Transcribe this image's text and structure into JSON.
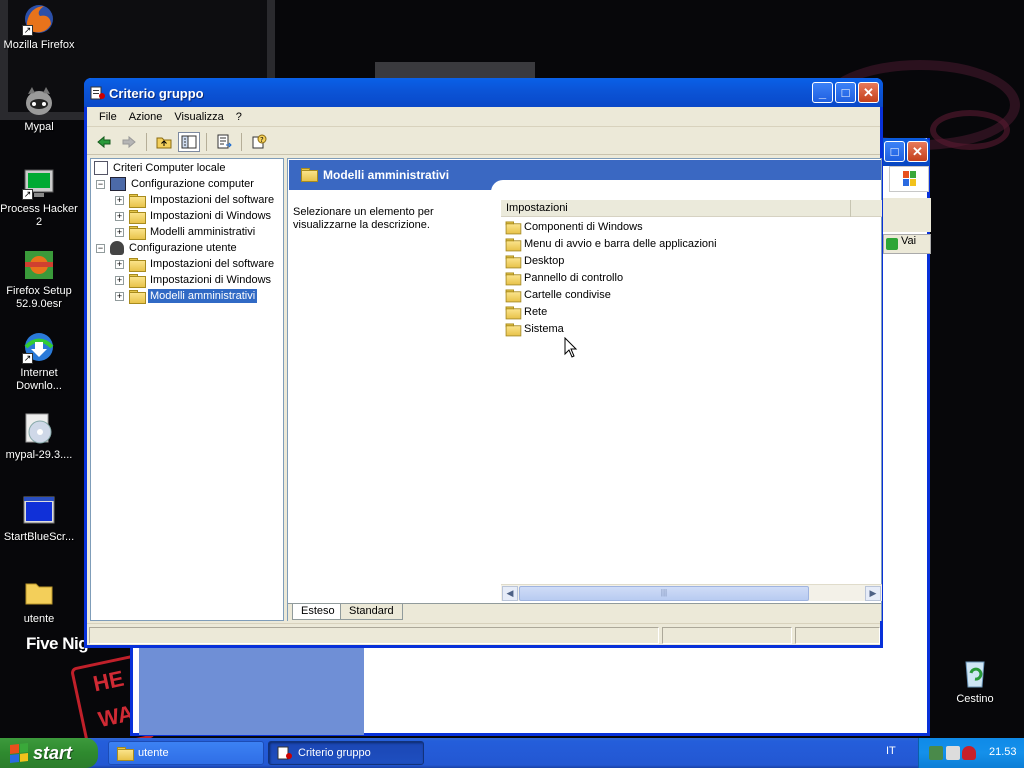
{
  "desktop": {
    "icons": [
      {
        "label": "Mozilla Firefox",
        "icon": "firefox-icon"
      },
      {
        "label": "Mypal",
        "icon": "mypal-icon"
      },
      {
        "label": "Process Hacker 2",
        "icon": "process-hacker-icon"
      },
      {
        "label": "Firefox Setup 52.9.0esr",
        "icon": "installer-icon"
      },
      {
        "label": "Internet Downlo...",
        "icon": "idm-icon"
      },
      {
        "label": "mypal-29.3....",
        "icon": "disc-icon"
      },
      {
        "label": "StartBlueScr...",
        "icon": "blue-screen-icon"
      },
      {
        "label": "utente",
        "icon": "folder-icon"
      },
      {
        "label": "Cestino",
        "icon": "recycle-bin-icon"
      }
    ],
    "wallpaper_text": "Five Nig",
    "neon_text": "HE WA"
  },
  "background_window": {
    "go_label": "Vai"
  },
  "window": {
    "title": "Criterio gruppo",
    "menu": [
      "File",
      "Azione",
      "Visualizza",
      "?"
    ],
    "toolbar": [
      "back-arrow-icon",
      "forward-arrow-icon",
      "up-folder-icon",
      "show-tree-icon",
      "export-list-icon",
      "help-icon"
    ],
    "tree": {
      "root": "Criteri Computer locale",
      "computer_config": "Configurazione computer",
      "computer_children": [
        "Impostazioni del software",
        "Impostazioni di Windows",
        "Modelli amministrativi"
      ],
      "user_config": "Configurazione utente",
      "user_children": [
        "Impostazioni del software",
        "Impostazioni di Windows",
        "Modelli amministrativi"
      ]
    },
    "header_title": "Modelli amministrativi",
    "description": "Selezionare un elemento per visualizzarne la descrizione.",
    "column_header": "Impostazioni",
    "items": [
      "Componenti di Windows",
      "Menu di avvio e barra delle applicazioni",
      "Desktop",
      "Pannello di controllo",
      "Cartelle condivise",
      "Rete",
      "Sistema"
    ],
    "tabs": [
      "Esteso",
      "Standard"
    ]
  },
  "taskbar": {
    "start_label": "start",
    "buttons": [
      "utente",
      "Criterio gruppo"
    ],
    "language": "IT",
    "clock": "21.53"
  },
  "colors": {
    "title_bar": "#0a55d8",
    "selection": "#316ac5",
    "taskbar": "#245edb",
    "start_green": "#2f8a2f"
  }
}
